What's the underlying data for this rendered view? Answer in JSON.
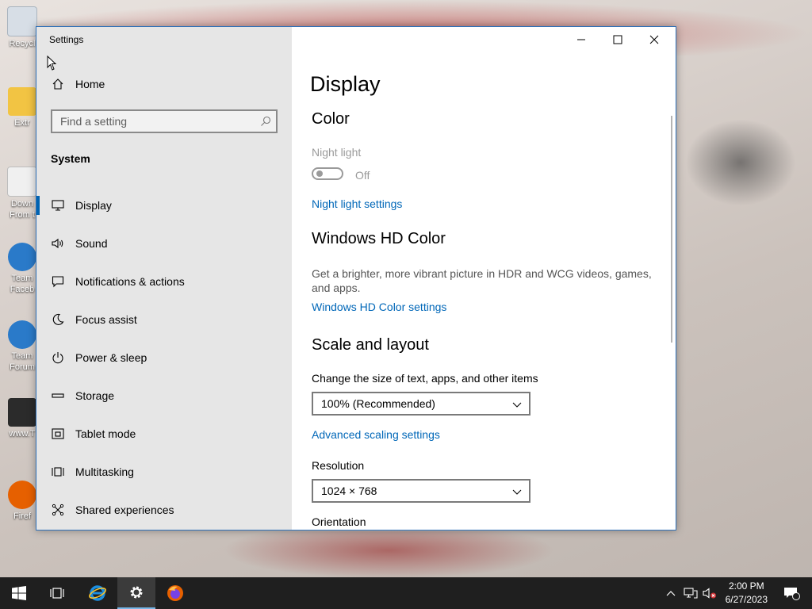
{
  "desktop": {
    "icons": [
      {
        "label": "Recycl",
        "color": "#c9d4df"
      },
      {
        "label": "Extr",
        "color": "#f4c542"
      },
      {
        "label": "Down From t",
        "color": "#e8e8e8"
      },
      {
        "label": "Team Faceb",
        "color": "#2a7ac9"
      },
      {
        "label": "Team Forum",
        "color": "#2a7ac9"
      },
      {
        "label": "www.T",
        "color": "#333333"
      },
      {
        "label": "Firef",
        "color": "#e66000"
      }
    ]
  },
  "window": {
    "title": "Settings",
    "controls": {
      "minimize": "minimize-icon",
      "maximize": "maximize-icon",
      "close": "close-icon"
    }
  },
  "sidebar": {
    "home_label": "Home",
    "search_placeholder": "Find a setting",
    "section": "System",
    "items": [
      {
        "label": "Display",
        "icon": "monitor-icon",
        "active": true
      },
      {
        "label": "Sound",
        "icon": "speaker-icon"
      },
      {
        "label": "Notifications & actions",
        "icon": "notification-icon"
      },
      {
        "label": "Focus assist",
        "icon": "moon-icon"
      },
      {
        "label": "Power & sleep",
        "icon": "power-icon"
      },
      {
        "label": "Storage",
        "icon": "storage-icon"
      },
      {
        "label": "Tablet mode",
        "icon": "tablet-icon"
      },
      {
        "label": "Multitasking",
        "icon": "multitasking-icon"
      },
      {
        "label": "Shared experiences",
        "icon": "shared-icon"
      }
    ]
  },
  "main": {
    "title": "Display",
    "color_heading": "Color",
    "night_light_label": "Night light",
    "night_light_state": "Off",
    "night_light_link": "Night light settings",
    "hdr_heading": "Windows HD Color",
    "hdr_desc": "Get a brighter, more vibrant picture in HDR and WCG videos, games, and apps.",
    "hdr_link": "Windows HD Color settings",
    "scale_heading": "Scale and layout",
    "scale_label": "Change the size of text, apps, and other items",
    "scale_value": "100% (Recommended)",
    "advanced_link": "Advanced scaling settings",
    "resolution_label": "Resolution",
    "resolution_value": "1024 × 768",
    "orientation_label": "Orientation"
  },
  "taskbar": {
    "time": "2:00 PM",
    "date": "6/27/2023",
    "notification_count": "1",
    "accent": "#78b7e8"
  }
}
